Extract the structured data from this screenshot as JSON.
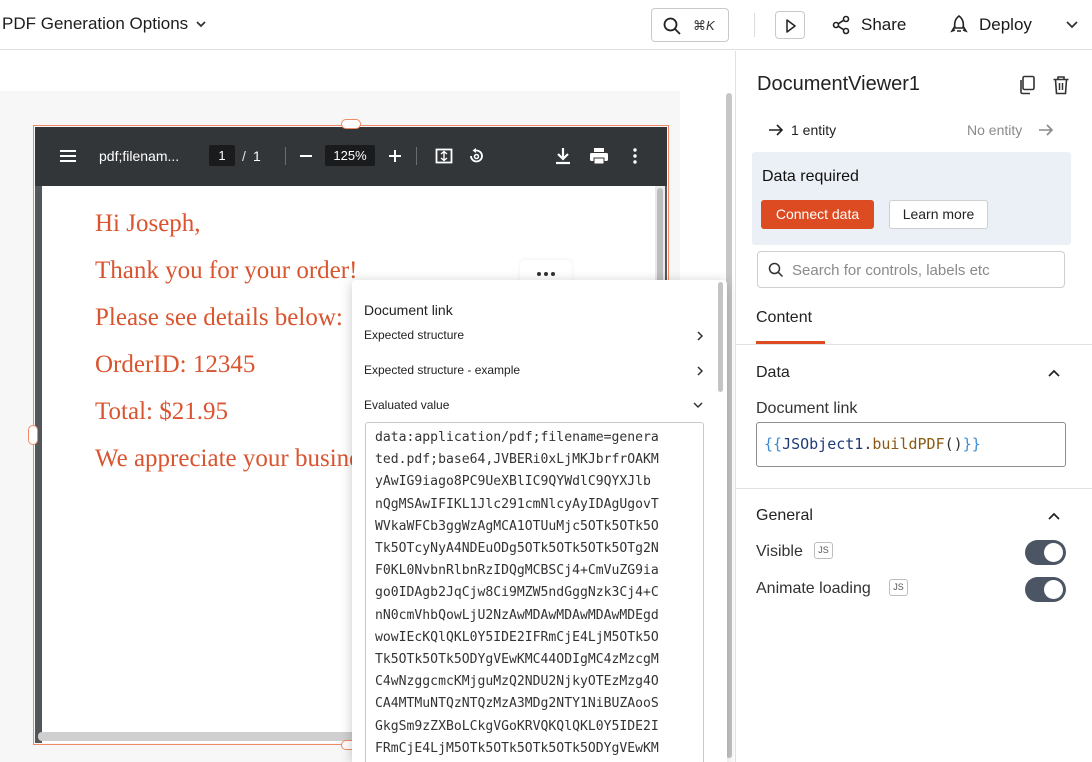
{
  "header": {
    "app_title": "PDF Generation Options",
    "search_shortcut": "⌘K",
    "share_label": "Share",
    "deploy_label": "Deploy"
  },
  "pdf_viewer": {
    "file_name": "pdf;filenam...",
    "current_page": "1",
    "page_separator": "/",
    "total_pages": "1",
    "zoom": "125%",
    "lines": [
      "Hi Joseph,",
      "Thank you for your order!",
      "Please see details below:",
      "OrderID: 12345",
      "Total: $21.95",
      "We appreciate your business!"
    ]
  },
  "popover": {
    "title": "Document link",
    "rows": [
      "Expected structure",
      "Expected structure - example",
      "Evaluated value"
    ],
    "evaluated_value_lines": [
      "data:application/pdf;filename=genera",
      "ted.pdf;base64,JVBERi0xLjMKJbrfrOAKM",
      "yAwIG9iago8PC9UeXBlIC9QYWdlC9QYXJlb",
      "nQgMSAwIFIKL1Jlc291cmNlcyAyIDAgUgovT",
      "WVkaWFCb3ggWzAgMCA1OTUuMjc5OTk5OTk5O",
      "Tk5OTcyNyA4NDEuODg5OTk5OTk5OTk5OTg2N",
      "F0KL0NvbnRlbnRzIDQgMCBSCj4+CmVuZG9ia",
      "go0IDAgb2JqCjw8Ci9MZW5ndGggNzk3Cj4+C",
      "nN0cmVhbQowLjU2NzAwMDAwMDAwMDAwMDEgd",
      "wowIEcKQlQKL0Y5IDE2IFRmCjE4LjM5OTk5O",
      "Tk5OTk5OTk5ODYgVEwKMC44ODIgMC4zMzcgM",
      "C4wNzggcmcKMjguMzQ2NDU2NjkyOTEzMzg4O",
      "CA4MTMuNTQzNTQzMzA3MDg2NTY1NiBUZAooS",
      "GkgSm9zZXBoLCkgVGoKRVQKQlQKL0Y5IDE2I",
      "FRmCjE4LjM5OTk5OTk5OTk5OTk5ODYgVEwKM"
    ]
  },
  "property_pane": {
    "widget_name": "DocumentViewer1",
    "entity_link": "1 entity",
    "no_entity": "No entity",
    "callout_title": "Data required",
    "connect_data": "Connect data",
    "learn_more": "Learn more",
    "search_placeholder": "Search for controls, labels etc",
    "tab_content": "Content",
    "section_data": "Data",
    "document_link_label": "Document link",
    "document_link_tokens": {
      "open": "{{",
      "object": "JSObject1",
      "dot": ".",
      "method": "buildPDF",
      "parens": "()",
      "close": "}}"
    },
    "section_general": "General",
    "visible_label": "Visible",
    "animate_loading_label": "Animate loading",
    "js_badge": "JS",
    "visible_on": true,
    "animate_loading_on": true
  },
  "colors": {
    "accent": "#dd4b22",
    "pdf_text": "#d9542f",
    "selection": "#f08a65",
    "toggle_on": "#4c5563"
  }
}
